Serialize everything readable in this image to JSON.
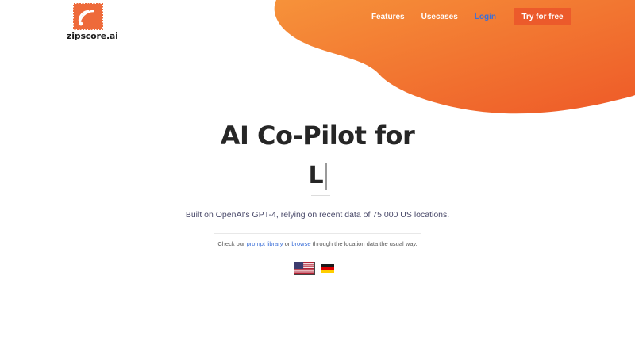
{
  "brand": {
    "name": "zipscore.ai",
    "accent_color": "#ec5a2b"
  },
  "nav": {
    "items": [
      {
        "label": "Features"
      },
      {
        "label": "Usecases"
      },
      {
        "label": "Login"
      }
    ],
    "cta_label": "Try for free"
  },
  "hero": {
    "title": "AI Co-Pilot for",
    "typed_text": "L",
    "subtitle": "Built on OpenAI's GPT-4, relying on recent data of 75,000 US locations."
  },
  "helper": {
    "prefix": "Check our",
    "prompt_library_label": "prompt library",
    "middle": "or",
    "browse_label": "browse",
    "suffix": "through the location data the usual way."
  },
  "languages": [
    {
      "icon": "us-flag-icon"
    },
    {
      "icon": "germany-flag-icon"
    }
  ]
}
